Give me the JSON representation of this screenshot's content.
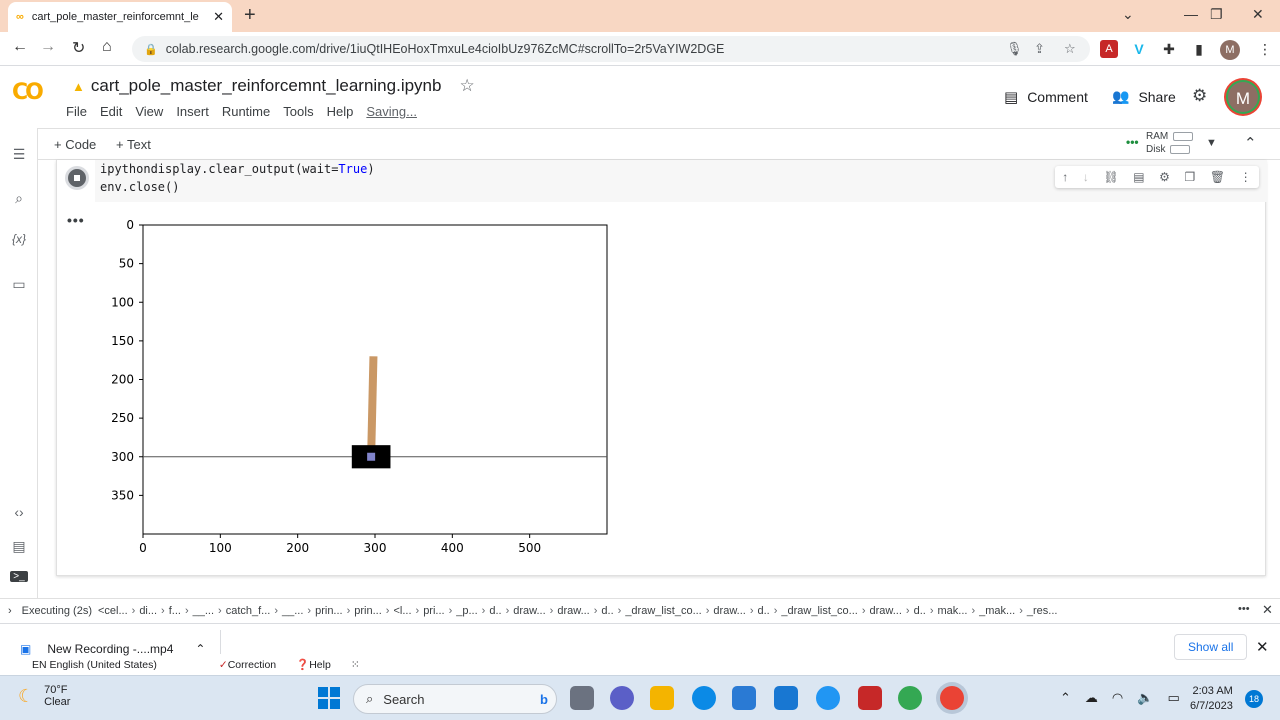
{
  "browser": {
    "tab_title": "cart_pole_master_reinforcemnt_le",
    "url": "colab.research.google.com/drive/1iuQtIHEoHoxTmxuLe4cioIbUz976ZcMC#scrollTo=2r5VaYIW2DGE",
    "profile_initial": "M"
  },
  "colab": {
    "logo": "CO",
    "notebook_title": "cart_pole_master_reinforcemnt_learning.ipynb",
    "menu": [
      "File",
      "Edit",
      "View",
      "Insert",
      "Runtime",
      "Tools",
      "Help"
    ],
    "saving": "Saving...",
    "comment_label": "Comment",
    "share_label": "Share",
    "avatar_initial": "M",
    "add_code": "+ Code",
    "add_text": "+ Text",
    "ram_label": "RAM",
    "disk_label": "Disk"
  },
  "cell": {
    "code_lines": [
      "ipythondisplay.clear_output(wait=",
      "True",
      ")",
      "env.close()"
    ],
    "output_menu": "•••"
  },
  "chart_data": {
    "type": "image",
    "x_ticks": [
      0,
      100,
      200,
      300,
      400,
      500
    ],
    "y_ticks": [
      0,
      50,
      100,
      150,
      200,
      250,
      300,
      350
    ],
    "xlim": [
      0,
      600
    ],
    "ylim": [
      400,
      0
    ],
    "ground_y": 300,
    "cart": {
      "x": 295,
      "y": 300,
      "width": 50,
      "height": 30
    },
    "pole": {
      "base_x": 295,
      "base_y": 300,
      "top_x": 298,
      "top_y": 170
    }
  },
  "status": {
    "executing": "Executing (2s)",
    "trace": [
      "<cel...",
      "di...",
      "f...",
      "__...",
      "catch_f...",
      "__...",
      "prin...",
      "prin...",
      "<l...",
      "pri...",
      "_p...",
      "d..",
      "draw...",
      "draw...",
      "d..",
      "_draw_list_co...",
      "draw...",
      "d..",
      "_draw_list_co...",
      "draw...",
      "d..",
      "mak...",
      "_mak...",
      "_res..."
    ]
  },
  "download": {
    "filename": "New Recording -....mp4",
    "show_all": "Show all"
  },
  "ime": {
    "lang": "EN English (United States)",
    "correction": "Correction",
    "help": "Help"
  },
  "taskbar": {
    "temp": "70°F",
    "condition": "Clear",
    "search": "Search",
    "time": "2:03 AM",
    "date": "6/7/2023",
    "notifications": "18"
  },
  "colors": {
    "tabstrip": "#f8d7c3",
    "cart": "#000000",
    "pole": "#ca9865",
    "axle": "#8184cb"
  }
}
